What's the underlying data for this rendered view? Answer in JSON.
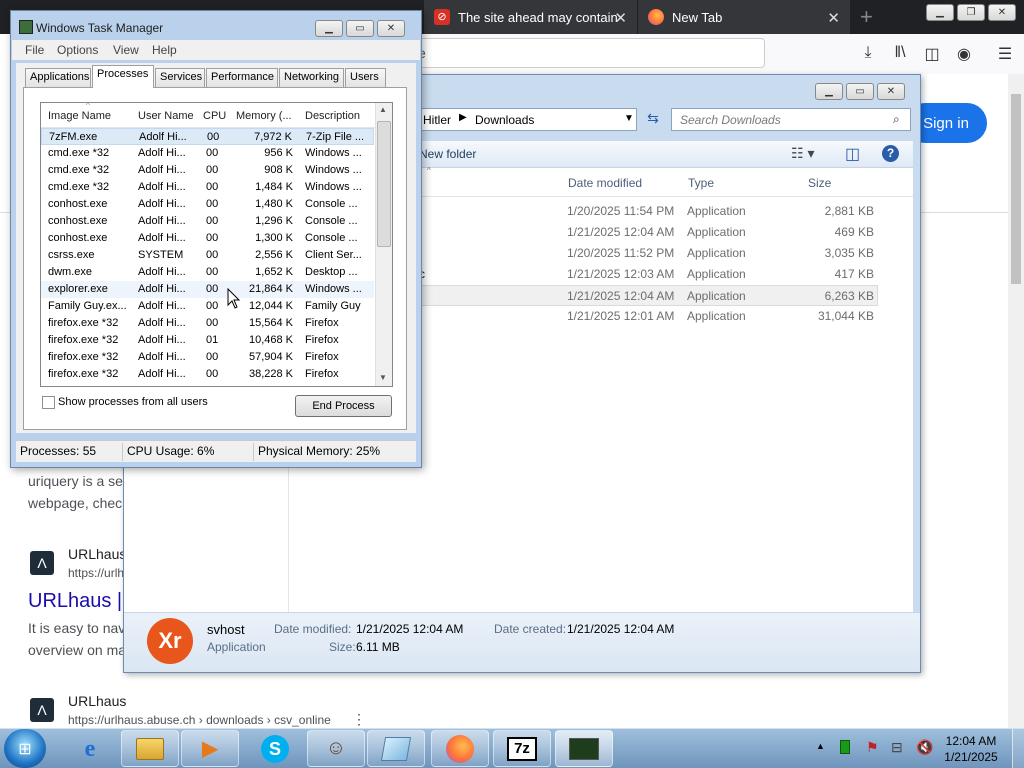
{
  "browser": {
    "tabs": [
      {
        "label": "The site ahead may contain h",
        "color": "#d93025"
      },
      {
        "label": "New Tab",
        "color": "#ff7139"
      }
    ],
    "new_tab_glyph": "+",
    "url_text": "e",
    "sign_in": "Sign in",
    "results": {
      "snippet1_line1": "uriquery is a se",
      "snippet1_line2": "webpage, chec",
      "site2_name": "URLhaus",
      "site2_url": "https://urlh",
      "title2": "URLhaus |",
      "snippet2_line1": "It is easy to nav",
      "snippet2_line2": "overview on ma",
      "site3_name": "URLhaus",
      "site3_url": "https://urlhaus.abuse.ch › downloads › csv_online"
    }
  },
  "explorer": {
    "breadcrumb": [
      "Hitler",
      "Downloads"
    ],
    "search_placeholder": "Search Downloads",
    "new_folder": "New folder",
    "columns": [
      "Date modified",
      "Type",
      "Size"
    ],
    "rows": [
      {
        "date": "1/20/2025 11:54 PM",
        "type": "Application",
        "size": "2,881 KB"
      },
      {
        "date": "1/21/2025 12:04 AM",
        "type": "Application",
        "size": "469 KB"
      },
      {
        "date": "1/20/2025 11:52 PM",
        "type": "Application",
        "size": "3,035 KB"
      },
      {
        "date": "1/21/2025 12:03 AM",
        "type": "Application",
        "size": "417 KB",
        "prefix": "c"
      },
      {
        "date": "1/21/2025 12:04 AM",
        "type": "Application",
        "size": "6,263 KB"
      },
      {
        "date": "1/21/2025 12:01 AM",
        "type": "Application",
        "size": "31,044 KB"
      }
    ],
    "details": {
      "name": "svhost",
      "type": "Application",
      "date_modified_label": "Date modified:",
      "date_modified": "1/21/2025 12:04 AM",
      "date_created_label": "Date created:",
      "date_created": "1/21/2025 12:04 AM",
      "size_label": "Size:",
      "size": "6.11 MB"
    }
  },
  "taskmgr": {
    "title": "Windows Task Manager",
    "menu": [
      "File",
      "Options",
      "View",
      "Help"
    ],
    "tabs": [
      "Applications",
      "Processes",
      "Services",
      "Performance",
      "Networking",
      "Users"
    ],
    "active_tab": "Processes",
    "columns": [
      "Image Name",
      "User Name",
      "CPU",
      "Memory (...",
      "Description"
    ],
    "rows": [
      {
        "name": "7zFM.exe",
        "user": "Adolf Hi...",
        "cpu": "00",
        "mem": "7,972 K",
        "desc": "7-Zip File ..."
      },
      {
        "name": "cmd.exe *32",
        "user": "Adolf Hi...",
        "cpu": "00",
        "mem": "956 K",
        "desc": "Windows ..."
      },
      {
        "name": "cmd.exe *32",
        "user": "Adolf Hi...",
        "cpu": "00",
        "mem": "908 K",
        "desc": "Windows ..."
      },
      {
        "name": "cmd.exe *32",
        "user": "Adolf Hi...",
        "cpu": "00",
        "mem": "1,484 K",
        "desc": "Windows ..."
      },
      {
        "name": "conhost.exe",
        "user": "Adolf Hi...",
        "cpu": "00",
        "mem": "1,480 K",
        "desc": "Console ..."
      },
      {
        "name": "conhost.exe",
        "user": "Adolf Hi...",
        "cpu": "00",
        "mem": "1,296 K",
        "desc": "Console ..."
      },
      {
        "name": "conhost.exe",
        "user": "Adolf Hi...",
        "cpu": "00",
        "mem": "1,300 K",
        "desc": "Console ..."
      },
      {
        "name": "csrss.exe",
        "user": "SYSTEM",
        "cpu": "00",
        "mem": "2,556 K",
        "desc": "Client Ser..."
      },
      {
        "name": "dwm.exe",
        "user": "Adolf Hi...",
        "cpu": "00",
        "mem": "1,652 K",
        "desc": "Desktop ..."
      },
      {
        "name": "explorer.exe",
        "user": "Adolf Hi...",
        "cpu": "00",
        "mem": "21,864 K",
        "desc": "Windows ..."
      },
      {
        "name": "Family Guy.ex...",
        "user": "Adolf Hi...",
        "cpu": "00",
        "mem": "12,044 K",
        "desc": "Family Guy"
      },
      {
        "name": "firefox.exe *32",
        "user": "Adolf Hi...",
        "cpu": "00",
        "mem": "15,564 K",
        "desc": "Firefox"
      },
      {
        "name": "firefox.exe *32",
        "user": "Adolf Hi...",
        "cpu": "01",
        "mem": "10,468 K",
        "desc": "Firefox"
      },
      {
        "name": "firefox.exe *32",
        "user": "Adolf Hi...",
        "cpu": "00",
        "mem": "57,904 K",
        "desc": "Firefox"
      },
      {
        "name": "firefox.exe *32",
        "user": "Adolf Hi...",
        "cpu": "00",
        "mem": "38,228 K",
        "desc": "Firefox"
      }
    ],
    "show_all_users": "Show processes from all users",
    "end_process": "End Process",
    "status": {
      "processes": "Processes: 55",
      "cpu": "CPU Usage: 6%",
      "memory": "Physical Memory: 25%"
    }
  },
  "taskbar": {
    "apps": [
      "internet-explorer",
      "file-explorer",
      "media-player",
      "skype",
      "family-guy",
      "notepad",
      "firefox",
      "7zip",
      "task-manager"
    ],
    "sevenzip_label": "7z",
    "time": "12:04 AM",
    "date": "1/21/2025"
  }
}
